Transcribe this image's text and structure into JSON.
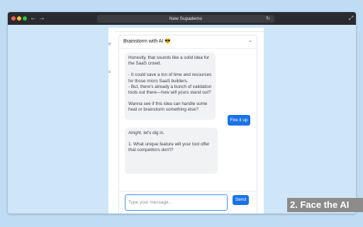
{
  "browser": {
    "title": "New Supademo",
    "nav_back": "←",
    "nav_forward": "→",
    "reload_icon": "↻",
    "fullscreen_icon": "⤢"
  },
  "app": {
    "edge_fragment_1": "e",
    "edge_fragment_2": "e",
    "panel": {
      "title": "Brainstorm with AI 😎",
      "chevron": "⌄"
    },
    "messages": {
      "ai_1": [
        "Honestly, that sounds like a solid idea for the SaaS crowd.",
        "- It could save a ton of time and resources for those micro SaaS builders.",
        "- But, there's already a bunch of validation tools out there—how will yours stand out?",
        "Wanna see if this idea can handle some heat or brainstorm something else?"
      ],
      "user_1": "Fire it up",
      "ai_2": [
        "Alright, let's dig in.",
        "1. What unique feature will your tool offer that competitors don't?"
      ]
    },
    "composer": {
      "placeholder": "Type your message...",
      "send_label": "Send"
    }
  },
  "banner": {
    "text": "2. Face the AI"
  }
}
